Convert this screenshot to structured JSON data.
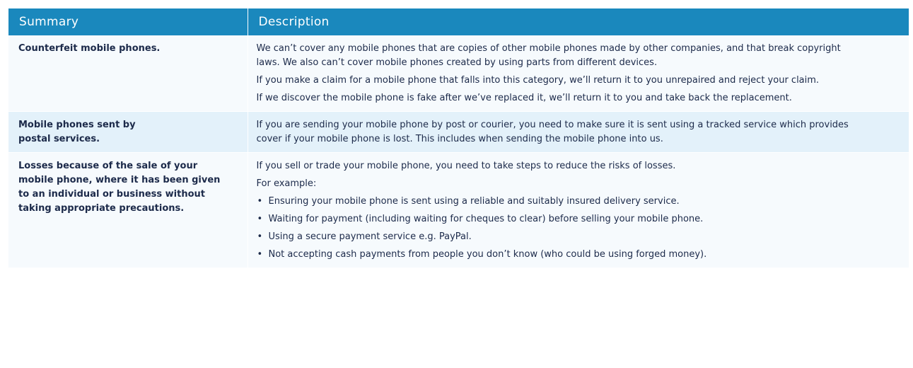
{
  "table": {
    "headers": {
      "summary": "Summary",
      "description": "Description"
    },
    "rows": [
      {
        "summary": "Counterfeit mobile phones.",
        "paragraphs": [
          "We can’t cover any mobile phones that are copies of other mobile phones made by other companies, and that break copyright laws. We also can’t cover mobile phones created by using parts from different devices.",
          "If you make a claim for a mobile phone that falls into this category, we’ll return it to you unrepaired and reject your claim.",
          "If we discover the mobile phone is fake after we’ve replaced it, we’ll return it to you and take back the replacement."
        ]
      },
      {
        "summary": "Mobile phones sent by postal services.",
        "paragraphs": [
          "If you are sending your mobile phone by post or courier, you need to make sure it is sent using a tracked service which provides cover if your mobile phone is lost. This includes when sending the mobile phone into us."
        ]
      },
      {
        "summary": "Losses because of the sale of your mobile phone, where it has been given to an individual or business without taking appropriate precautions.",
        "paragraphs": [
          "If you sell or trade your mobile phone, you need to take steps to reduce the risks of losses.",
          "For example:"
        ],
        "bullet_glyph": "•",
        "bullets": [
          "Ensuring your mobile phone is sent using a reliable and suitably insured delivery service.",
          "Waiting for payment (including waiting for cheques to clear) before selling your mobile phone.",
          "Using a secure payment service e.g. PayPal.",
          "Not accepting cash payments from people you don’t know (who could be using forged money)."
        ]
      }
    ]
  },
  "colors": {
    "header_bg": "#1a88bd",
    "row_light": "#f6fafd",
    "row_tint": "#e3f1fa",
    "text": "#1c2a4a"
  }
}
